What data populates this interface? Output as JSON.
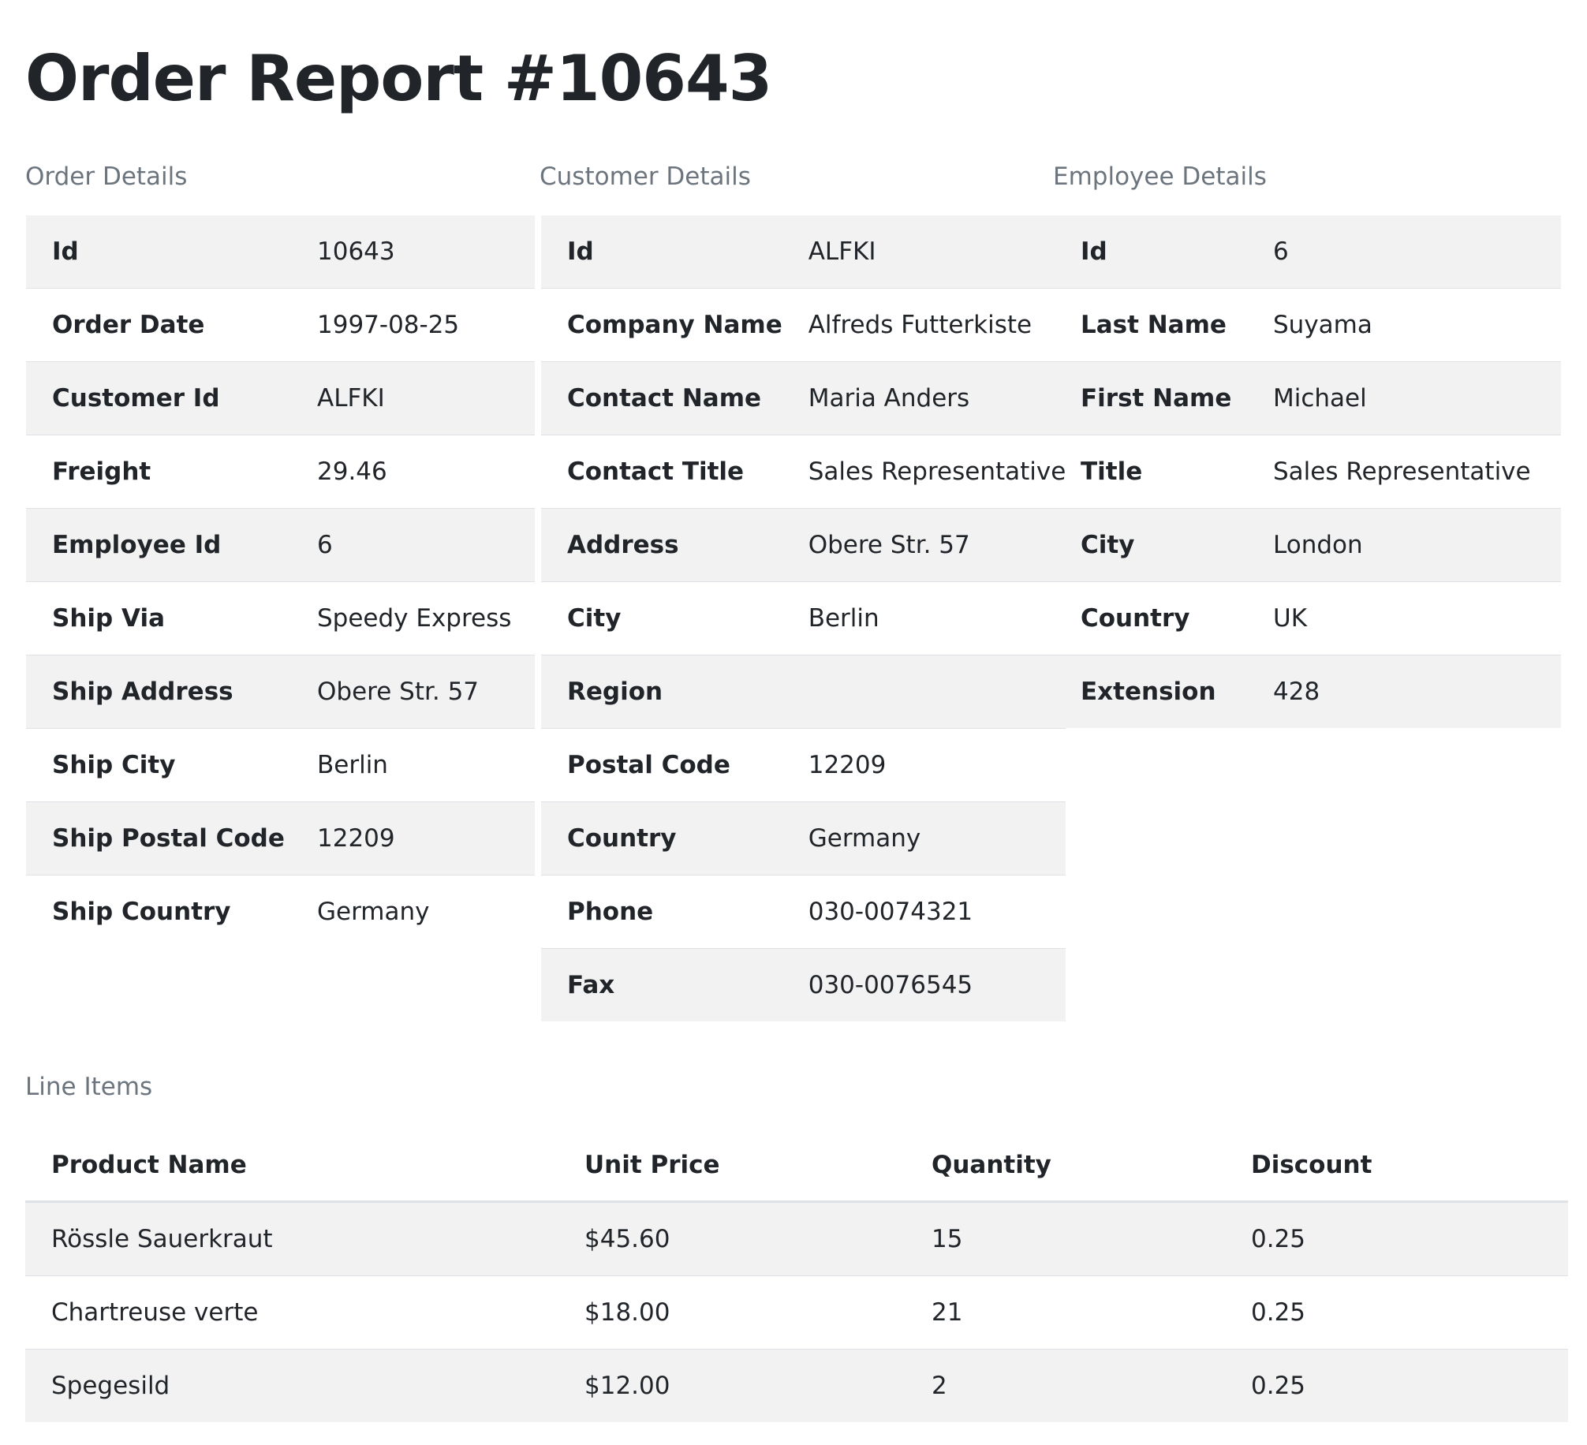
{
  "title": "Order Report #10643",
  "order": {
    "caption": "Order Details",
    "rows": [
      {
        "label": "Id",
        "value": "10643"
      },
      {
        "label": "Order Date",
        "value": "1997-08-25"
      },
      {
        "label": "Customer Id",
        "value": "ALFKI"
      },
      {
        "label": "Freight",
        "value": "29.46"
      },
      {
        "label": "Employee Id",
        "value": "6"
      },
      {
        "label": "Ship Via",
        "value": "Speedy Express"
      },
      {
        "label": "Ship Address",
        "value": "Obere Str. 57"
      },
      {
        "label": "Ship City",
        "value": "Berlin"
      },
      {
        "label": "Ship Postal Code",
        "value": "12209"
      },
      {
        "label": "Ship Country",
        "value": "Germany"
      }
    ]
  },
  "customer": {
    "caption": "Customer Details",
    "rows": [
      {
        "label": "Id",
        "value": "ALFKI"
      },
      {
        "label": "Company Name",
        "value": "Alfreds Futterkiste"
      },
      {
        "label": "Contact Name",
        "value": "Maria Anders"
      },
      {
        "label": "Contact Title",
        "value": "Sales Representative"
      },
      {
        "label": "Address",
        "value": "Obere Str. 57"
      },
      {
        "label": "City",
        "value": "Berlin"
      },
      {
        "label": "Region",
        "value": ""
      },
      {
        "label": "Postal Code",
        "value": "12209"
      },
      {
        "label": "Country",
        "value": "Germany"
      },
      {
        "label": "Phone",
        "value": "030-0074321"
      },
      {
        "label": "Fax",
        "value": "030-0076545"
      }
    ]
  },
  "employee": {
    "caption": "Employee Details",
    "rows": [
      {
        "label": "Id",
        "value": "6"
      },
      {
        "label": "Last Name",
        "value": "Suyama"
      },
      {
        "label": "First Name",
        "value": "Michael"
      },
      {
        "label": "Title",
        "value": "Sales Representative"
      },
      {
        "label": "City",
        "value": "London"
      },
      {
        "label": "Country",
        "value": "UK"
      },
      {
        "label": "Extension",
        "value": "428"
      }
    ]
  },
  "line_items": {
    "caption": "Line Items",
    "headers": [
      "Product Name",
      "Unit Price",
      "Quantity",
      "Discount"
    ],
    "rows": [
      [
        "Rössle Sauerkraut",
        "$45.60",
        "15",
        "0.25"
      ],
      [
        "Chartreuse verte",
        "$18.00",
        "21",
        "0.25"
      ],
      [
        "Spegesild",
        "$12.00",
        "2",
        "0.25"
      ]
    ]
  }
}
